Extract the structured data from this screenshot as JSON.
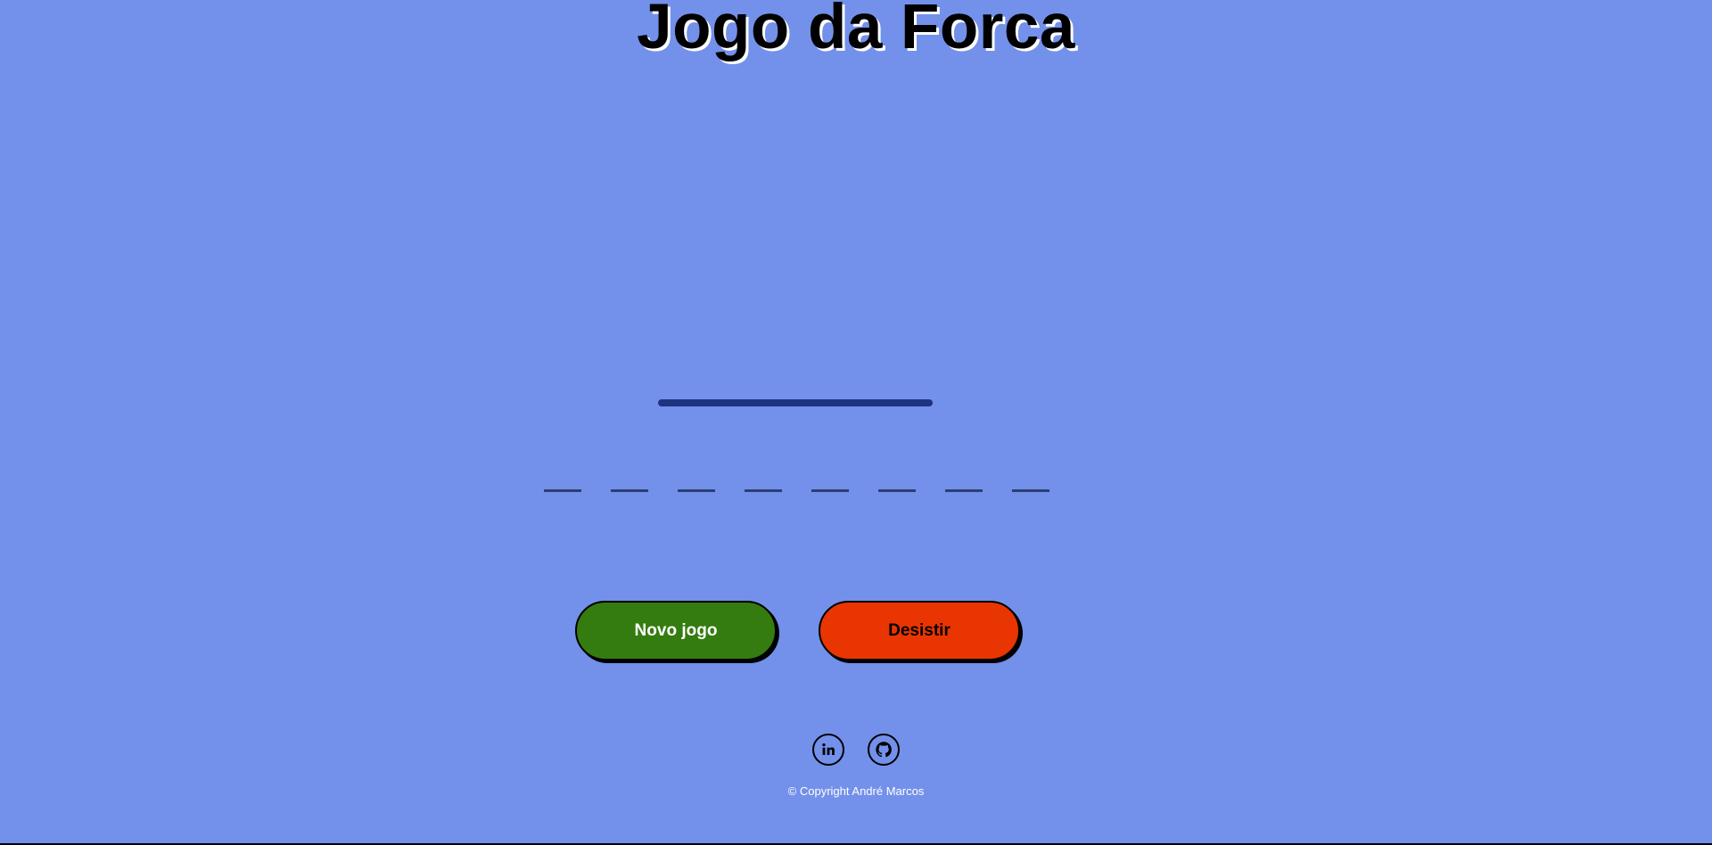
{
  "game": {
    "title": "Jogo da Forca",
    "letter_slots": [
      "",
      "",
      "",
      "",
      "",
      "",
      "",
      ""
    ]
  },
  "buttons": {
    "new_game_label": "Novo jogo",
    "give_up_label": "Desistir"
  },
  "footer": {
    "social_icons": [
      "linkedin-icon",
      "github-icon"
    ],
    "copyright": "© Copyright André Marcos"
  },
  "colors": {
    "background": "#7391ea",
    "new_game_button": "#357c10",
    "give_up_button": "#e93502",
    "gallows": "#1e3380"
  }
}
